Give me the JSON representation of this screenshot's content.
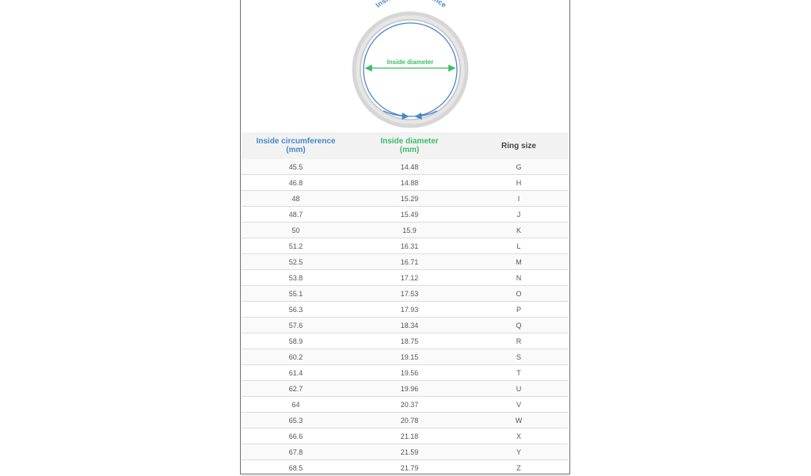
{
  "diagram": {
    "circumference_label": "Inside circumference",
    "diameter_label": "Inside diameter",
    "colors": {
      "circumference": "#4a86c8",
      "diameter": "#3dbb6b",
      "ring": "#c9c9c9"
    }
  },
  "table": {
    "headers": {
      "circumference": [
        "Inside circumference",
        "(mm)"
      ],
      "diameter": [
        "Inside diameter",
        "(mm)"
      ],
      "size": "Ring size"
    },
    "rows": [
      [
        "45.5",
        "14.48",
        "G"
      ],
      [
        "46.8",
        "14.88",
        "H"
      ],
      [
        "48",
        "15.29",
        "I"
      ],
      [
        "48.7",
        "15.49",
        "J"
      ],
      [
        "50",
        "15.9",
        "K"
      ],
      [
        "51.2",
        "16.31",
        "L"
      ],
      [
        "52.5",
        "16.71",
        "M"
      ],
      [
        "53.8",
        "17.12",
        "N"
      ],
      [
        "55.1",
        "17.53",
        "O"
      ],
      [
        "56.3",
        "17.93",
        "P"
      ],
      [
        "57.6",
        "18.34",
        "Q"
      ],
      [
        "58.9",
        "18.75",
        "R"
      ],
      [
        "60.2",
        "19.15",
        "S"
      ],
      [
        "61.4",
        "19.56",
        "T"
      ],
      [
        "62.7",
        "19.96",
        "U"
      ],
      [
        "64",
        "20.37",
        "V"
      ],
      [
        "65.3",
        "20.78",
        "W"
      ],
      [
        "66.6",
        "21.18",
        "X"
      ],
      [
        "67.8",
        "21.59",
        "Y"
      ],
      [
        "68.5",
        "21.79",
        "Z"
      ]
    ]
  }
}
